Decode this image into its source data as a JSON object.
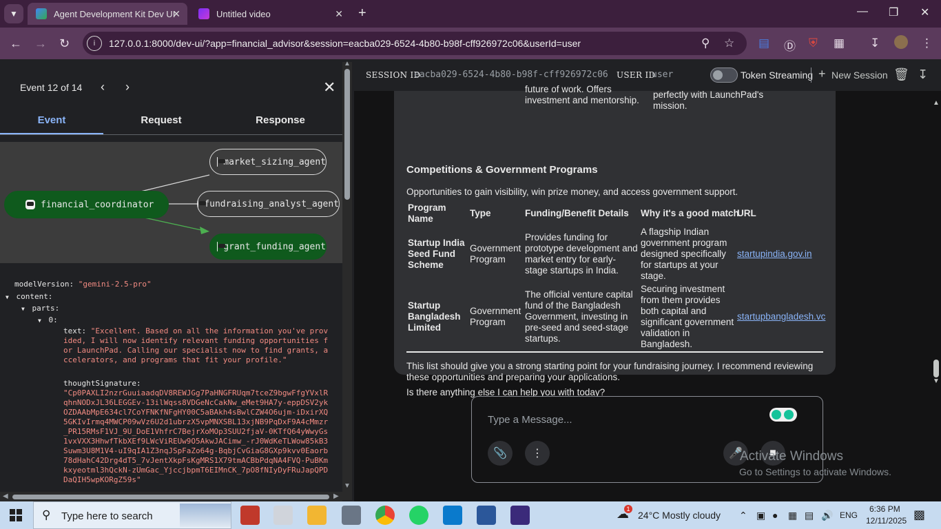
{
  "browser": {
    "tabs": [
      {
        "title": "Agent Development Kit Dev UI",
        "active": true
      },
      {
        "title": "Untitled video",
        "active": false
      }
    ],
    "url": "127.0.0.1:8000/dev-ui/?app=financial_advisor&session=eacba029-6524-4b80-b98f-cff926972c06&userId=user"
  },
  "event_panel": {
    "title": "Event 12 of 14",
    "tabs": [
      "Event",
      "Request",
      "Response"
    ],
    "active_tab": "Event",
    "graph": {
      "nodes": [
        {
          "label": "market_sizing_agent"
        },
        {
          "label": "financial_coordinator"
        },
        {
          "label": "fundraising_analyst_agent"
        },
        {
          "label": "grant_funding_agent"
        }
      ]
    },
    "json": {
      "model_version_key": "modelVersion:",
      "model_version_value": "\"gemini-2.5-pro\"",
      "content_key": "content:",
      "parts_key": "parts:",
      "index_key": "0:",
      "text_key": "text:",
      "text_value": "\"Excellent. Based on all the information you've provided, I will now identify relevant funding opportunities for LaunchPad. Calling our specialist now to find grants, accelerators, and programs that fit your profile.\"",
      "thought_key": "thoughtSignature:",
      "thought_value": "\"Cp0PAXLI2nzrGuuiaadqDV8REWJGg7PaHNGFRUqm7tceZ9bgwFfgYVxlRqhnNODxJL36LEGGEv-13ilWqss8VDGeNcCakNw_eMet9HA7y-eppDSV2ykOZDAAbMpE634cl7CoYFNKfNFgHY00C5aBAkh4sBwlCZW4O6ujm-iDxirXQ5GKIvIrmq4MWCP09wVz6U2d1ubrzX5vpMNXSBL13xjNB9PqDxF9A4cMmzr_PR15RMsF1VJ_9U_DoE1VhfrC7BejrXoMOp3SUU2fjaV-0KTfQ64yWwyGs1vxVXX3HhwfTkbXEf9LWcViREUw9O5AkwJACimw_-rJ0WdKeTLWow85kB3Suwm3U8M1V4-uI9qIA1Z3nqJSpFaZo64g-BqbjCvGiaG8GXp9kvv0Eaorb78dHahC42Drg4dT5_7vJentXkpFsKgMRS1X79tmACBbPdqNA4FVQ-PuBKmkxyeotml3hQckN-zUmGac_YjccjbpmT6EIMnCK_7pO8fNIyDyFRuJapQPDDaQIH5wpKORgZ59s\""
    }
  },
  "session_bar": {
    "session_label": "SESSION ID",
    "session_id": "eacba029-6524-4b80-b98f-cff926972c06",
    "user_label": "USER ID",
    "user_id": "user",
    "streaming_label": "Token Streaming",
    "new_session_label": "New Session"
  },
  "chat": {
    "top_left_fragment": "future of work. Offers investment and mentorship.",
    "top_right_fragment": "perfectly with LaunchPad's mission.",
    "section_heading": "Competitions & Government Programs",
    "section_intro": "Opportunities to gain visibility, win prize money, and access government support.",
    "table_headers": [
      "Program Name",
      "Type",
      "Funding/Benefit Details",
      "Why it's a good match",
      "URL"
    ],
    "rows": [
      {
        "name": "Startup India Seed Fund Scheme",
        "type": "Government Program",
        "details": "Provides funding for prototype development and market entry for early-stage startups in India.",
        "why": "A flagship Indian government program designed specifically for startups at your stage.",
        "url": "startupindia.gov.in"
      },
      {
        "name": "Startup Bangladesh Limited",
        "type": "Government Program",
        "details": "The official venture capital fund of the Bangladesh Government, investing in pre-seed and seed-stage startups.",
        "why": "Securing investment from them provides both capital and significant government validation in Bangladesh.",
        "url": "startupbangladesh.vc"
      }
    ],
    "closing": "This list should give you a strong starting point for your fundraising journey. I recommend reviewing these opportunities and preparing your applications.",
    "question": "Is there anything else I can help you with today?",
    "input_placeholder": "Type a Message..."
  },
  "watermark": {
    "line1": "Activate Windows",
    "line2": "Go to Settings to activate Windows."
  },
  "taskbar": {
    "search_placeholder": "Type here to search",
    "weather": "24°C  Mostly cloudy",
    "weather_badge": "1",
    "language": "ENG",
    "time": "6:36 PM",
    "date": "12/11/2025"
  },
  "colors": {
    "tab_strip": "#3c1f3d",
    "toolbar": "#5b3a5c",
    "accent_blue": "#8ab4f8",
    "node_green": "#0f5a1d",
    "json_string": "#f28b82"
  }
}
